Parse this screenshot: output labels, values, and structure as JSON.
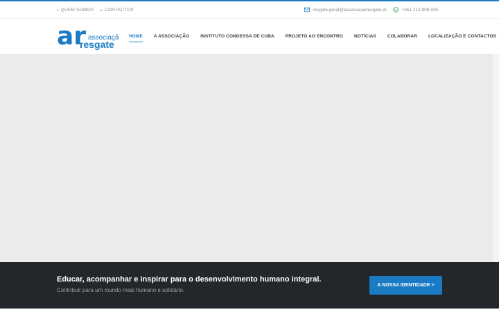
{
  "topbar": {
    "links": [
      {
        "label": "QUEM SOMOS"
      },
      {
        "label": "CONTACTOS"
      }
    ],
    "email": "resgate.geral@associacaoresgate.pt",
    "phone": "+351 213 909 935"
  },
  "logo": {
    "mark": "ar",
    "line1": "associação",
    "line2": "resgate"
  },
  "nav": {
    "items": [
      {
        "label": "HOME",
        "active": true
      },
      {
        "label": "A ASSOCIAÇÃO"
      },
      {
        "label": "INSTITUTO CONDESSA DE CUBA"
      },
      {
        "label": "PROJETO AO ENCONTRO"
      },
      {
        "label": "NOTÍCIAS"
      },
      {
        "label": "COLABORAR"
      },
      {
        "label": "LOCALIZAÇÃO E CONTACTOS"
      }
    ]
  },
  "footer": {
    "tagline": "Educar, acompanhar e inspirar para o desenvolvimento humano integral.",
    "subtagline": "Contribuir para um mundo mais humano e solidário.",
    "cta_label": "A NOSSA IDENTIDADE >"
  },
  "colors": {
    "accent": "#1a7bc4",
    "dark_band": "#23272b",
    "hero_bg": "#ebebeb"
  }
}
